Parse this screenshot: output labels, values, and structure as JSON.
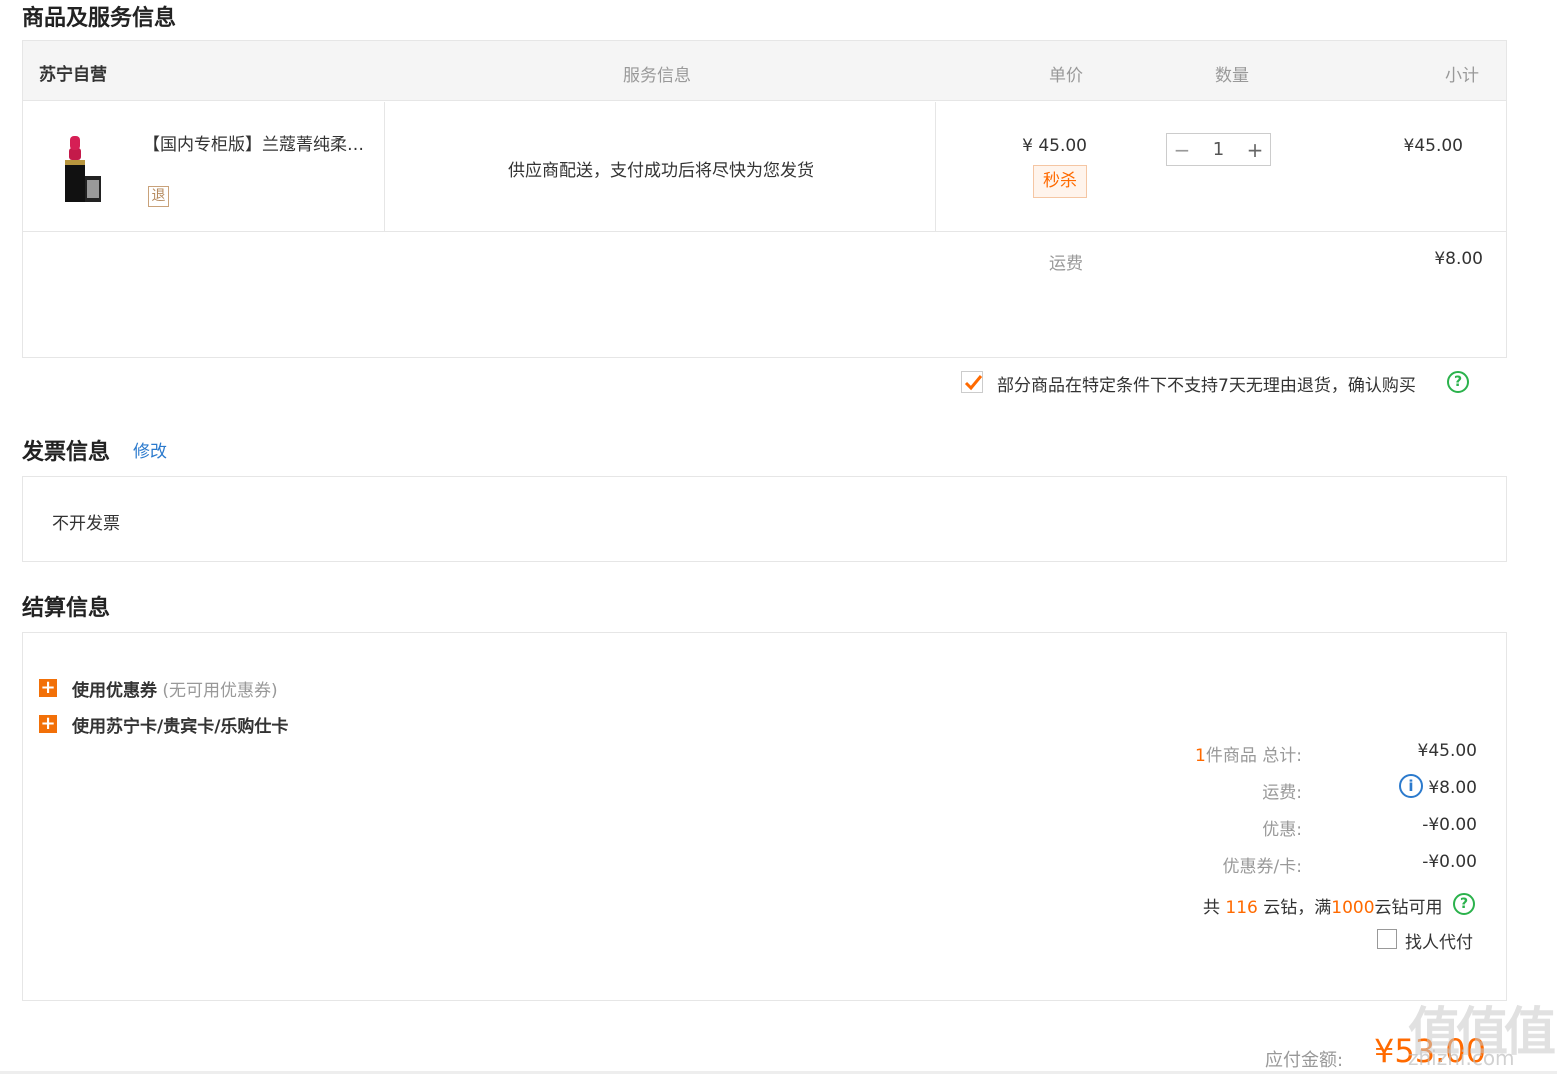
{
  "goods_section": {
    "title": "商品及服务信息",
    "header": {
      "store": "苏宁自营",
      "service": "服务信息",
      "unit_price": "单价",
      "quantity": "数量",
      "subtotal": "小计"
    },
    "item": {
      "name": "【国内专柜版】兰蔻菁纯柔…",
      "return_badge": "退",
      "service_text": "供应商配送，支付成功后将尽快为您发货",
      "price": "¥ 45.00",
      "tag": "秒杀",
      "qty_minus": "−",
      "qty": "1",
      "qty_plus": "+",
      "subtotal": "¥45.00"
    },
    "freight_label": "运费",
    "freight_value": "¥8.00",
    "return_notice": "部分商品在特定条件下不支持7天无理由退货，确认购买",
    "help": "?"
  },
  "invoice_section": {
    "title": "发票信息",
    "edit": "修改",
    "value": "不开发票"
  },
  "settlement_section": {
    "title": "结算信息",
    "coupon_label": "使用优惠券",
    "coupon_note": "(无可用优惠券)",
    "card_label": "使用苏宁卡/贵宾卡/乐购仕卡",
    "plus": "+",
    "count_num": "1",
    "count_text": "件商品 总计:",
    "total": "¥45.00",
    "freight_label": "运费:",
    "info_icon": "i",
    "freight": "¥8.00",
    "discount_label": "优惠:",
    "discount": "-¥0.00",
    "coupon_card_label": "优惠券/卡:",
    "coupon_card": "-¥0.00",
    "diamonds_prefix": "共",
    "diamonds_count": "116",
    "diamonds_mid": "云钻，满",
    "diamonds_threshold": "1000",
    "diamonds_suffix": "云钻可用",
    "help": "?",
    "proxy_pay": "找人代付"
  },
  "payable": {
    "label": "应付金额:",
    "value": "¥53.00"
  },
  "watermark": {
    "text": "zhizhi.com",
    "logo": "值值值"
  }
}
